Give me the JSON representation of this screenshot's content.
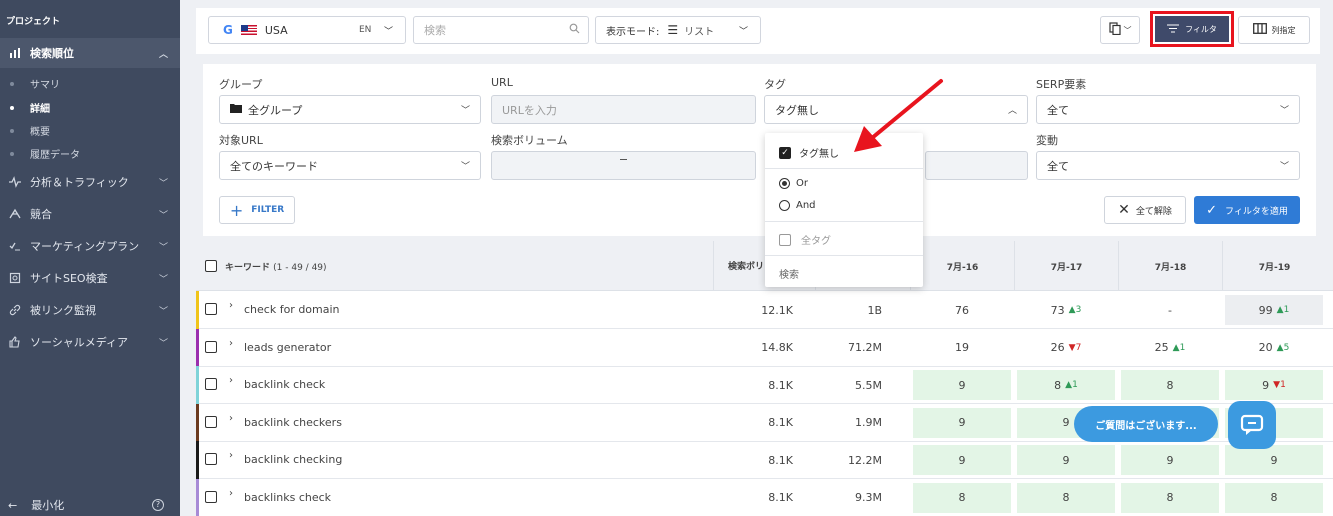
{
  "sidebar": {
    "project": "プロジェクト",
    "items": [
      {
        "label": "検索順位",
        "icon": "bar-chart-icon"
      },
      {
        "label": "分析＆トラフィック",
        "icon": "pulse-icon"
      },
      {
        "label": "競合",
        "icon": "competitors-icon"
      },
      {
        "label": "マーケティングプラン",
        "icon": "list-check-icon"
      },
      {
        "label": "サイトSEO検査",
        "icon": "audit-icon"
      },
      {
        "label": "被リンク監視",
        "icon": "link-icon"
      },
      {
        "label": "ソーシャルメディア",
        "icon": "thumbs-up-icon"
      }
    ],
    "subitems": [
      "サマリ",
      "詳細",
      "概要",
      "履歴データ"
    ],
    "minimize": "最小化"
  },
  "topbar": {
    "country": "USA",
    "lang": "EN",
    "search_placeholder": "検索",
    "view_mode_label": "表示モード:",
    "view_mode_value": "リスト",
    "filter_label": "フィルタ",
    "columns_label": "列指定"
  },
  "filters": {
    "group_label": "グループ",
    "group_value": "全グループ",
    "url_label": "URL",
    "url_placeholder": "URLを入力",
    "tag_label": "タグ",
    "tag_value": "タグ無し",
    "serp_label": "SERP要素",
    "serp_value": "全て",
    "target_url_label": "対象URL",
    "target_url_value": "全てのキーワード",
    "volume_label": "検索ボリューム",
    "change_label": "変動",
    "change_value": "全て",
    "filter_button": "FILTER",
    "clear_button": "全て解除",
    "apply_button": "フィルタを適用"
  },
  "tag_dropdown": {
    "checked_option": "タグ無し",
    "or_label": "Or",
    "and_label": "And",
    "all_tags": "全タグ",
    "search": "検索"
  },
  "table": {
    "keyword_header": "キーワード",
    "keyword_count": "(1 - 49 / 49)",
    "volume_header": "検索ボリ",
    "dates": [
      "7月-16",
      "7月-17",
      "7月-18",
      "7月-19"
    ],
    "rows": [
      {
        "keyword": "check for domain",
        "volume": "12.1K",
        "results": "1B",
        "bar": "#f0c419",
        "ranks": [
          {
            "v": "76"
          },
          {
            "v": "73",
            "d": "3",
            "dir": "up"
          },
          {
            "v": "-"
          },
          {
            "v": "99",
            "d": "1",
            "dir": "up",
            "bg": "grey"
          }
        ]
      },
      {
        "keyword": "leads generator",
        "volume": "14.8K",
        "results": "71.2M",
        "bar": "#9b2fae",
        "ranks": [
          {
            "v": "19"
          },
          {
            "v": "26",
            "d": "7",
            "dir": "down"
          },
          {
            "v": "25",
            "d": "1",
            "dir": "up"
          },
          {
            "v": "20",
            "d": "5",
            "dir": "up"
          }
        ]
      },
      {
        "keyword": "backlink check",
        "volume": "8.1K",
        "results": "5.5M",
        "bar": "#7fd3d8",
        "ranks": [
          {
            "v": "9",
            "bg": "green"
          },
          {
            "v": "8",
            "d": "1",
            "dir": "up",
            "bg": "green"
          },
          {
            "v": "8",
            "bg": "green"
          },
          {
            "v": "9",
            "d": "1",
            "dir": "down",
            "bg": "green"
          }
        ]
      },
      {
        "keyword": "backlink checkers",
        "volume": "8.1K",
        "results": "1.9M",
        "bar": "#6b3a1f",
        "ranks": [
          {
            "v": "9",
            "bg": "green"
          },
          {
            "v": "9",
            "bg": "green"
          },
          {
            "v": "",
            "bg": "green"
          },
          {
            "v": "",
            "bg": "green"
          }
        ]
      },
      {
        "keyword": "backlink checking",
        "volume": "8.1K",
        "results": "12.2M",
        "bar": "#1a1a1a",
        "ranks": [
          {
            "v": "9",
            "bg": "green"
          },
          {
            "v": "9",
            "bg": "green"
          },
          {
            "v": "9",
            "bg": "green"
          },
          {
            "v": "9",
            "bg": "green"
          }
        ]
      },
      {
        "keyword": "backlinks check",
        "volume": "8.1K",
        "results": "9.3M",
        "bar": "#a78bd6",
        "ranks": [
          {
            "v": "8",
            "bg": "green"
          },
          {
            "v": "8",
            "bg": "green"
          },
          {
            "v": "8",
            "bg": "green"
          },
          {
            "v": "8",
            "bg": "green"
          }
        ]
      }
    ]
  },
  "chat": {
    "bubble": "ご質問はございます..."
  },
  "colors": {
    "sidebar": "#3f4a5f",
    "accent": "#2f7bd6",
    "highlight": "#e8141e",
    "arrow": "#e8141e"
  }
}
